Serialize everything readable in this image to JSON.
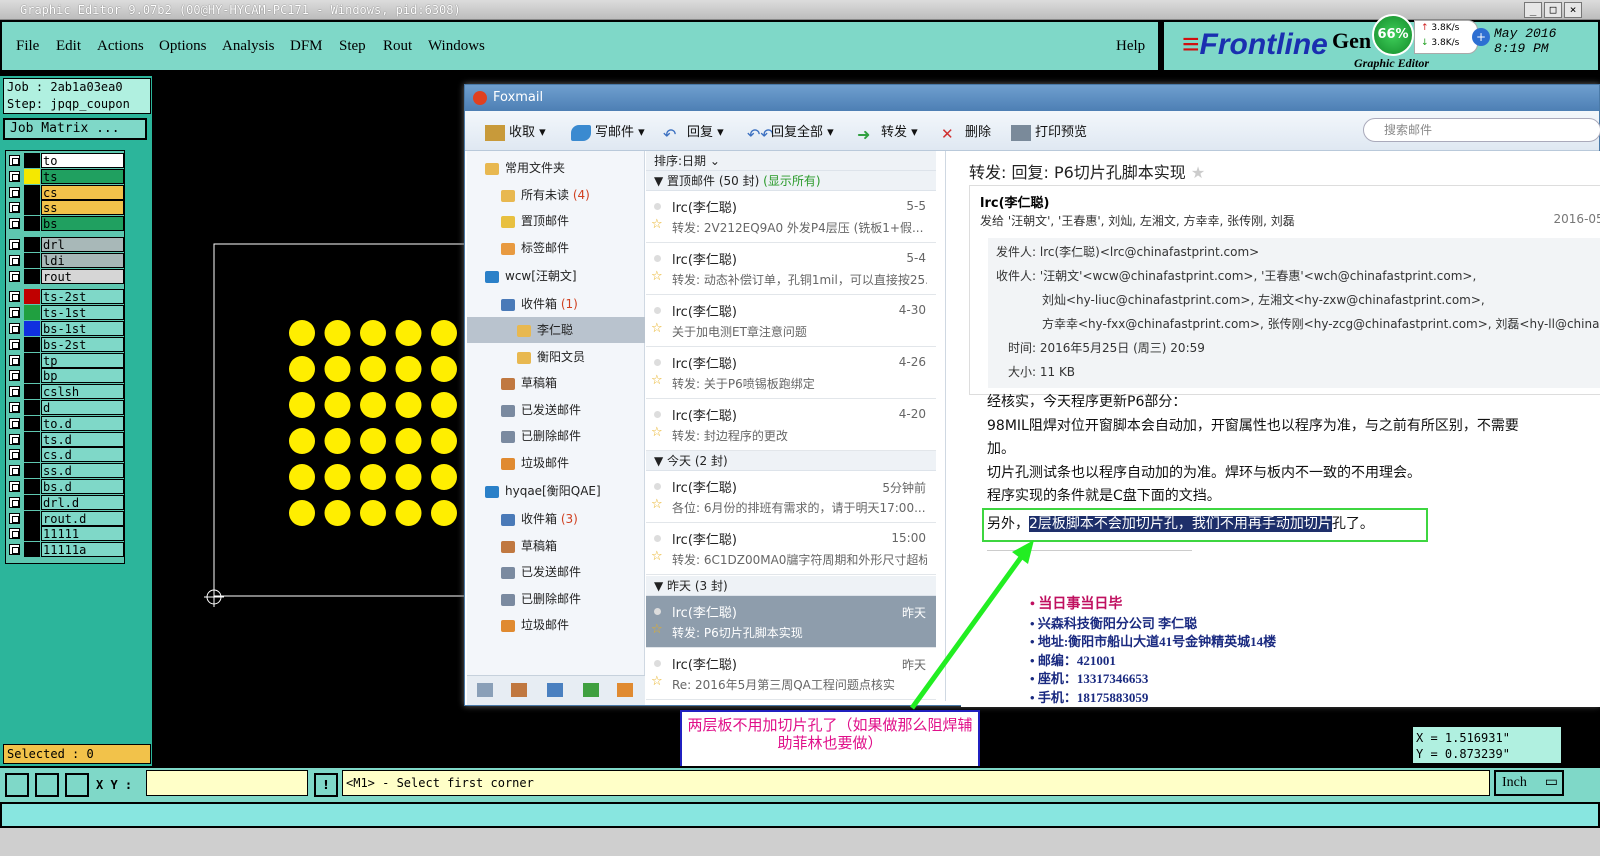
{
  "window": {
    "title": "Graphic Editor 9.07b2 (00@HY-HYCAM-PC171 - Windows, pid:6308)"
  },
  "menu": {
    "items": [
      "File",
      "Edit",
      "Actions",
      "Options",
      "Analysis",
      "DFM",
      "Step",
      "Rout",
      "Windows"
    ],
    "help": "Help"
  },
  "brand": {
    "name": "Frontline",
    "gen": "Gen",
    "subtitle": "Graphic Editor",
    "date": "May 2016",
    "time": "8:19 PM"
  },
  "tray": {
    "percent": "66%",
    "up": "3.8K/s",
    "down": "3.8K/s"
  },
  "job": {
    "job_label": "Job : 2ab1a03ea0",
    "step_label": "Step: jpqp_coupon",
    "matrix_button": "Job Matrix ..."
  },
  "layers": [
    {
      "name": "to",
      "swatch": "#000000",
      "bg": "#ffffff"
    },
    {
      "name": "ts",
      "swatch": "#f5e800",
      "bg": "#20a060"
    },
    {
      "name": "cs",
      "swatch": "#000000",
      "bg": "#f2c24a"
    },
    {
      "name": "ss",
      "swatch": "#000000",
      "bg": "#f2c24a"
    },
    {
      "name": "bs",
      "swatch": "#000000",
      "bg": "#20a060"
    },
    {
      "name": "drl",
      "swatch": "#000000",
      "bg": "#a8b8b8"
    },
    {
      "name": "ldi",
      "swatch": "#000000",
      "bg": "#a8b8b8"
    },
    {
      "name": "rout",
      "swatch": "#000000",
      "bg": "#d6d6d6"
    },
    {
      "name": "ts-2st",
      "swatch": "#c00000",
      "bg": "#7fd8c8"
    },
    {
      "name": "ts-1st",
      "swatch": "#20a040",
      "bg": "#7fd8c8"
    },
    {
      "name": "bs-1st",
      "swatch": "#1030e0",
      "bg": "#7fd8c8"
    },
    {
      "name": "bs-2st",
      "swatch": "#000000",
      "bg": "#7fd8c8"
    },
    {
      "name": "tp",
      "swatch": "#000000",
      "bg": "#7fd8c8"
    },
    {
      "name": "bp",
      "swatch": "#000000",
      "bg": "#7fd8c8"
    },
    {
      "name": "cslsh",
      "swatch": "#000000",
      "bg": "#7fd8c8"
    },
    {
      "name": "d",
      "swatch": "#000000",
      "bg": "#7fd8c8"
    },
    {
      "name": "to.d",
      "swatch": "#000000",
      "bg": "#7fd8c8"
    },
    {
      "name": "ts.d",
      "swatch": "#000000",
      "bg": "#7fd8c8"
    },
    {
      "name": "cs.d",
      "swatch": "#000000",
      "bg": "#7fd8c8"
    },
    {
      "name": "ss.d",
      "swatch": "#000000",
      "bg": "#7fd8c8"
    },
    {
      "name": "bs.d",
      "swatch": "#000000",
      "bg": "#7fd8c8"
    },
    {
      "name": "drl.d",
      "swatch": "#000000",
      "bg": "#7fd8c8"
    },
    {
      "name": "rout.d",
      "swatch": "#000000",
      "bg": "#7fd8c8"
    },
    {
      "name": "11111",
      "swatch": "#000000",
      "bg": "#7fd8c8"
    },
    {
      "name": "11111a",
      "swatch": "#000000",
      "bg": "#7fd8c8"
    }
  ],
  "selected": "Selected : 0",
  "coords": {
    "x": "X = 1.516931\"",
    "y": "Y = 0.873239\""
  },
  "command": {
    "xy_label": "X Y :",
    "prompt": "<M1> - Select first corner",
    "unit": "Inch"
  },
  "foxmail": {
    "title": "Foxmail",
    "toolbar": [
      "收取",
      "写邮件",
      "回复",
      "回复全部",
      "转发",
      "删除",
      "打印预览"
    ],
    "search_placeholder": "搜索邮件",
    "folders": [
      {
        "label": "常用文件夹",
        "count": ""
      },
      {
        "label": "所有未读",
        "count": "(4)"
      },
      {
        "label": "置顶邮件",
        "count": ""
      },
      {
        "label": "标签邮件",
        "count": ""
      },
      {
        "label": "wcw[汪朝文]",
        "count": ""
      },
      {
        "label": "收件箱",
        "count": "(1)"
      },
      {
        "label": "李仁聪",
        "count": ""
      },
      {
        "label": "衡阳文员",
        "count": ""
      },
      {
        "label": "草稿箱",
        "count": ""
      },
      {
        "label": "已发送邮件",
        "count": ""
      },
      {
        "label": "已删除邮件",
        "count": ""
      },
      {
        "label": "垃圾邮件",
        "count": ""
      },
      {
        "label": "hyqae[衡阳QAE]",
        "count": ""
      },
      {
        "label": "收件箱",
        "count": "(3)"
      },
      {
        "label": "草稿箱",
        "count": ""
      },
      {
        "label": "已发送邮件",
        "count": ""
      },
      {
        "label": "已删除邮件",
        "count": ""
      },
      {
        "label": "垃圾邮件",
        "count": ""
      }
    ],
    "sort_label": "排序:日期",
    "groups": [
      {
        "label": "置顶邮件 (50 封)",
        "extra": "(显示所有)"
      },
      {
        "label": "今天 (2 封)",
        "extra": ""
      },
      {
        "label": "昨天 (3 封)",
        "extra": ""
      }
    ],
    "mails": [
      {
        "from": "lrc(李仁聪)",
        "date": "5-5",
        "subject": "转发: 2V212EQ9A0  外发P4层压  (铣板1+假..."
      },
      {
        "from": "lrc(李仁聪)",
        "date": "5-4",
        "subject": "转发: 动态补偿订单，孔铜1mil，可以直接按25..."
      },
      {
        "from": "lrc(李仁聪)",
        "date": "4-30",
        "subject": "关于加电测ET章注意问题"
      },
      {
        "from": "lrc(李仁聪)",
        "date": "4-26",
        "subject": "转发: 关于P6喷锡板跑绑定"
      },
      {
        "from": "lrc(李仁聪)",
        "date": "4-20",
        "subject": "转发: 封边程序的更改"
      },
      {
        "from": "lrc(李仁聪)",
        "date": "5分钟前",
        "subject": "各位: 6月份的排班有需求的，请于明天17:00..."
      },
      {
        "from": "lrc(李仁聪)",
        "date": "15:00",
        "subject": "转发: 6C1DZ00MA0牖字符周期和外形尺寸超标"
      },
      {
        "from": "lrc(李仁聪)",
        "date": "昨天",
        "subject": "转发: P6切片孔脚本实现"
      },
      {
        "from": "lrc(李仁聪)",
        "date": "昨天",
        "subject": "Re: 2016年5月第三周QA工程问题点核实"
      }
    ],
    "reader": {
      "title": "转发: 回复: P6切片孔脚本实现",
      "from_name": "lrc(李仁聪)",
      "to_summary": "发给 '汪朝文', '王春惠', 刘灿, 左湘文, 方幸幸, 张传刚, 刘磊",
      "date_short": "2016-05-",
      "details": [
        "发件人: lrc(李仁聪)<lrc@chinafastprint.com>",
        "收件人: '汪朝文'<wcw@chinafastprint.com>, '王春惠'<wch@chinafastprint.com>,",
        "刘灿<hy-liuc@chinafastprint.com>, 左湘文<hy-zxw@chinafastprint.com>,",
        "方幸幸<hy-fxx@chinafastprint.com>, 张传刚<hy-zcg@chinafastprint.com>, 刘磊<hy-ll@china",
        "时间: 2016年5月25日 (周三) 20:59",
        "大小: 11 KB"
      ],
      "body": [
        "经核实，今天程序更新P6部分：",
        "98MIL阻焊对位开窗脚本会自动加，开窗属性也以程序为准，与之前有所区别，不需要",
        "加。",
        "切片孔测试条也以程序自动加的为准。焊环与板内不一致的不用理会。",
        "程序实现的条件就是C盘下面的文挡。"
      ],
      "last_line_prefix": "另外，",
      "last_line_highlight": "2层板脚本不会加切片孔，我们不用再手动加切片",
      "last_line_suffix": "孔了。",
      "signature": [
        "当日事当日毕",
        "兴森科技衡阳分公司    李仁聪",
        "地址:衡阳市船山大道41号金钟精英城14楼",
        "邮编：421001",
        "座机：13317346653",
        "手机：18175883059"
      ]
    }
  },
  "annotation": "两层板不用加切片孔了（如果做那么阻焊辅助菲林也要做）"
}
